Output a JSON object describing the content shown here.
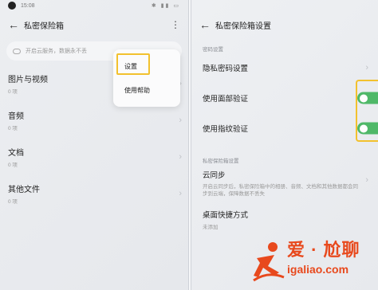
{
  "left": {
    "status": {
      "time": "15:08",
      "icons": "✱ ▮▮ ▭"
    },
    "header": {
      "title": "私密保险箱",
      "back_icon": "arrow-left-icon",
      "more_icon": "more-vertical-icon"
    },
    "notice": {
      "text": "开启云服务，数据永不丢"
    },
    "items": [
      {
        "label": "图片与视频",
        "sub": "0 项"
      },
      {
        "label": "音频",
        "sub": "0 项"
      },
      {
        "label": "文档",
        "sub": "0 项"
      },
      {
        "label": "其他文件",
        "sub": "0 项"
      }
    ],
    "popup": {
      "settings": "设置",
      "help": "使用帮助"
    },
    "highlight_color": "#f2c12e"
  },
  "right": {
    "header": {
      "title": "私密保险箱设置",
      "back_icon": "arrow-left-icon"
    },
    "section1": "密码设置",
    "rows": {
      "password": "隐私密码设置",
      "face": "使用面部验证",
      "fingerprint": "使用指纹验证"
    },
    "face_enabled": true,
    "fingerprint_enabled": true,
    "toggle_color": "#4fb868",
    "section2": "私密保险箱设置",
    "cloud": {
      "label": "云同步",
      "desc": "开启云同步后，私密保险箱中的相册、音频、文档和其他数据都会同步到云端，保障数据不丢失"
    },
    "shortcut": {
      "label": "桌面快捷方式",
      "sub": "未添加"
    }
  },
  "watermark": {
    "cn": "爱 · 尬聊",
    "url": "igaliao.com",
    "color": "#e8491d"
  }
}
